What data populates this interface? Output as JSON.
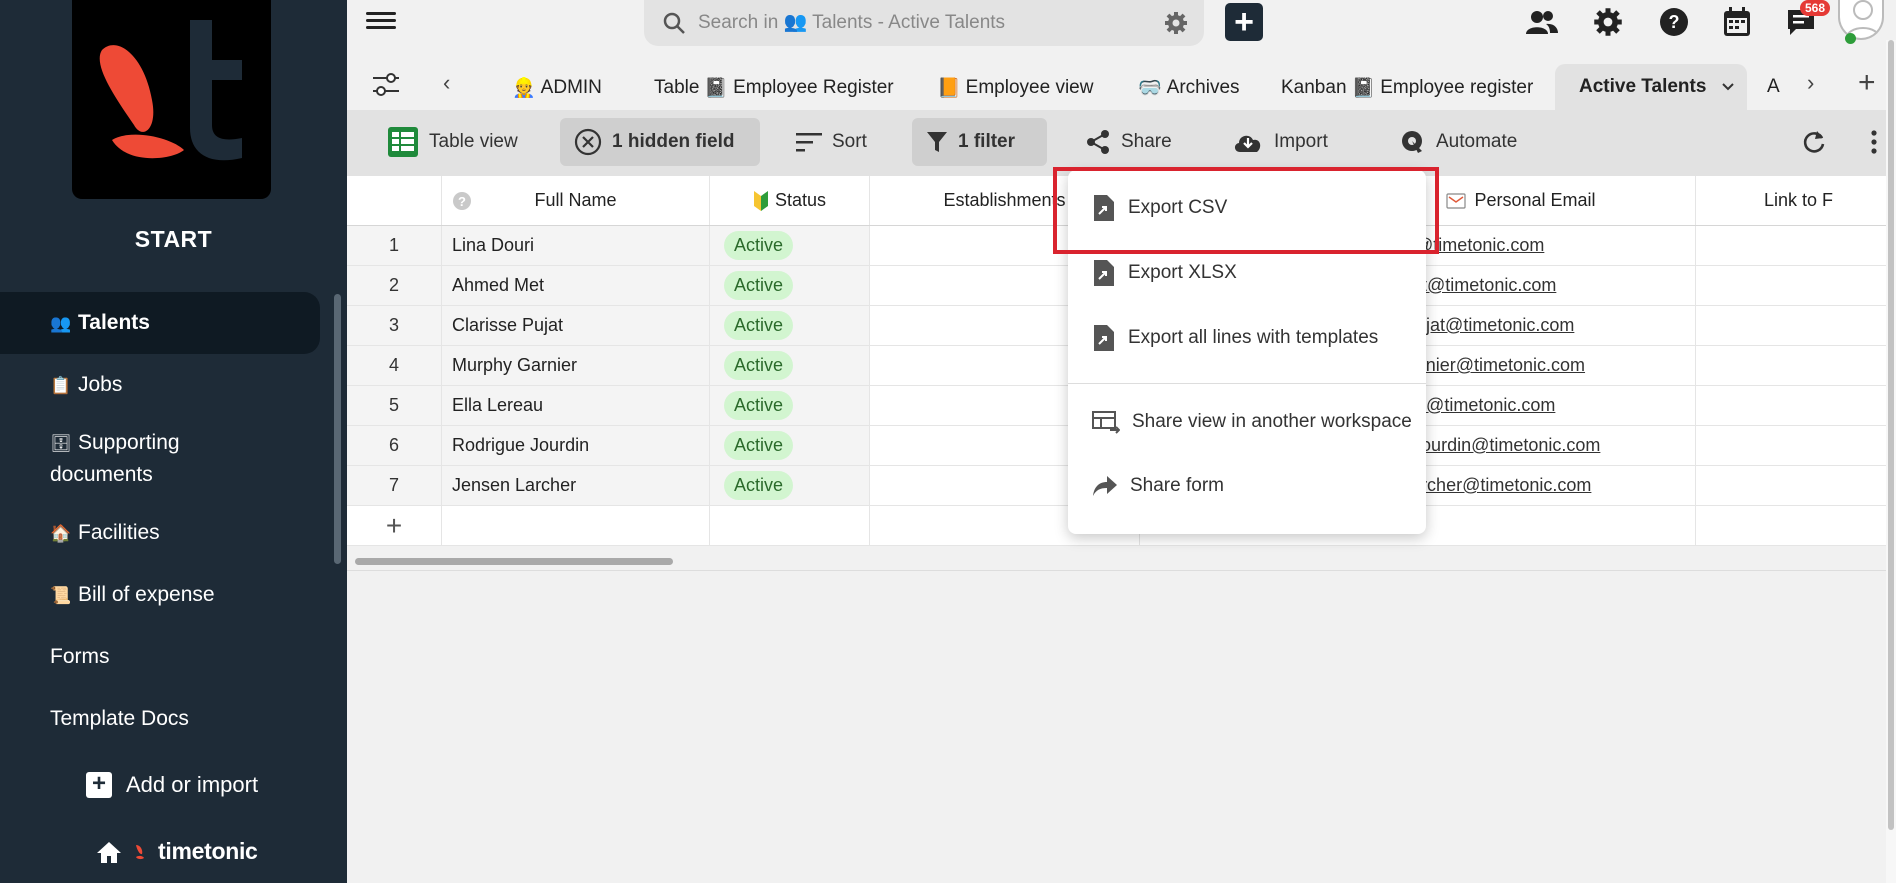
{
  "sidebar": {
    "title": "START",
    "items": [
      {
        "label": "Talents",
        "icon": "👥"
      },
      {
        "label": "Jobs",
        "icon": "📋"
      },
      {
        "label": "Supporting",
        "label2": "documents",
        "icon": "🗄"
      },
      {
        "label": "Facilities",
        "icon": "🏠"
      },
      {
        "label": "Bill of expense",
        "icon": "📜"
      },
      {
        "label": "Forms"
      },
      {
        "label": "Template Docs"
      }
    ],
    "add_import": "Add or import",
    "brand": "timetonic"
  },
  "topbar": {
    "search_placeholder": "Search in 👥 Talents - Active Talents",
    "notification_count": "568"
  },
  "tabs": [
    {
      "label": "ADMIN",
      "icon": "👷"
    },
    {
      "label": "Table",
      "icon2": "📓",
      "label2": "Employee Register"
    },
    {
      "label": "Employee view",
      "icon": "📙"
    },
    {
      "label": "Archives",
      "icon": "🥽"
    },
    {
      "label": "Kanban",
      "icon2": "📓",
      "label2": "Employee register"
    },
    {
      "label": "Active Talents"
    },
    {
      "label": "A"
    }
  ],
  "toolbar": {
    "table_view": "Table view",
    "hidden_field": "1 hidden field",
    "sort": "Sort",
    "filter": "1 filter",
    "share": "Share",
    "import": "Import",
    "automate": "Automate"
  },
  "table": {
    "columns": {
      "name": "Full Name",
      "status": "Status",
      "est": "Establishments",
      "email": "Personal Email",
      "link": "Link to F"
    },
    "rows": [
      {
        "num": "1",
        "name": "Lina Douri",
        "status": "Active",
        "email": "na.Douri@timetonic.com"
      },
      {
        "num": "2",
        "name": "Ahmed Met",
        "status": "Active",
        "email": "hmed.Met@timetonic.com"
      },
      {
        "num": "3",
        "name": "Clarisse Pujat",
        "status": "Active",
        "email": "larisse.Pujat@timetonic.com"
      },
      {
        "num": "4",
        "name": "Murphy Garnier",
        "status": "Active",
        "email": "urphy.Garnier@timetonic.com"
      },
      {
        "num": "5",
        "name": "Ella Lereau",
        "status": "Active",
        "email": "lla.Lereau@timetonic.com"
      },
      {
        "num": "6",
        "name": "Rodrigue Jourdin",
        "status": "Active",
        "email": "odrigue.Jourdin@timetonic.com"
      },
      {
        "num": "7",
        "name": "Jensen Larcher",
        "status": "Active",
        "email": "ensen.Larcher@timetonic.com"
      }
    ]
  },
  "share_menu": {
    "export_csv": "Export CSV",
    "export_xlsx": "Export XLSX",
    "export_all": "Export all lines with templates",
    "share_view": "Share view in another workspace",
    "share_form": "Share form"
  },
  "colors": {
    "sidebar_bg": "#1e2b37",
    "brand_red": "#ee4a36",
    "active_pill": "#d2f5d0",
    "highlight": "#d9232e"
  }
}
